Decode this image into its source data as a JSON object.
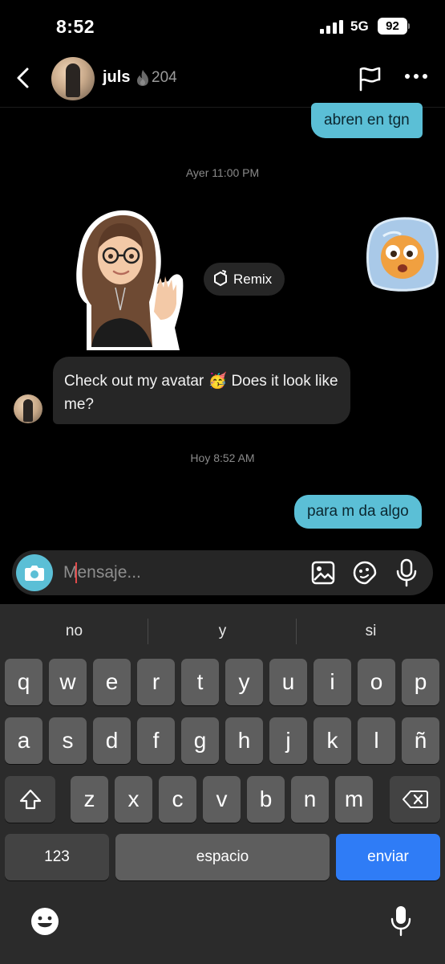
{
  "status_bar": {
    "time": "8:52",
    "network": "5G",
    "battery": "92"
  },
  "header": {
    "username": "juls",
    "streak_count": "204"
  },
  "messages": {
    "outgoing_top": "abren en tgn",
    "timestamp_yesterday": "Ayer 11:00 PM",
    "remix_label": "Remix",
    "incoming_text": "Check out my avatar 🥳 Does it look like me?",
    "timestamp_today": "Hoy 8:52 AM",
    "outgoing_bottom": "para m da algo"
  },
  "composer": {
    "placeholder": "Mensaje..."
  },
  "keyboard": {
    "suggestions": [
      "no",
      "y",
      "si"
    ],
    "row1": [
      "q",
      "w",
      "e",
      "r",
      "t",
      "y",
      "u",
      "i",
      "o",
      "p"
    ],
    "row2": [
      "a",
      "s",
      "d",
      "f",
      "g",
      "h",
      "j",
      "k",
      "l",
      "ñ"
    ],
    "row3": [
      "z",
      "x",
      "c",
      "v",
      "b",
      "n",
      "m"
    ],
    "numbers_label": "123",
    "space_label": "espacio",
    "send_label": "enviar"
  },
  "colors": {
    "accent": "#5bbfd6",
    "send_key": "#2f7cf6",
    "bubble_in": "#262626"
  },
  "icons": [
    "back-icon",
    "flame-icon",
    "flag-icon",
    "more-icon",
    "remix-icon",
    "camera-icon",
    "gallery-icon",
    "sticker-icon",
    "mic-icon",
    "shift-icon",
    "backspace-icon",
    "emoji-icon",
    "dictation-icon"
  ]
}
